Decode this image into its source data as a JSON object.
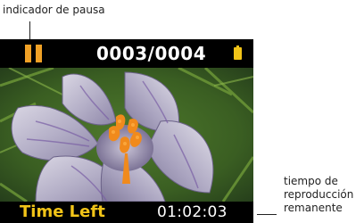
{
  "callouts": {
    "pause_indicator": "indicador de pausa",
    "remaining_time": [
      "tiempo de",
      "reproducción",
      "remanente"
    ]
  },
  "player": {
    "state": "paused",
    "track_counter": "0003/0004",
    "time_left_label": "Time Left",
    "time_left_value": "01:02:03",
    "battery_level": 1.0
  },
  "colors": {
    "pause_icon": "#f0a126",
    "battery_icon": "#f2c418",
    "time_left_label": "#f2c418",
    "bars_background": "#000000",
    "counter_text": "#ffffff"
  },
  "icons": {
    "pause": "pause-icon",
    "battery": "battery-icon"
  }
}
